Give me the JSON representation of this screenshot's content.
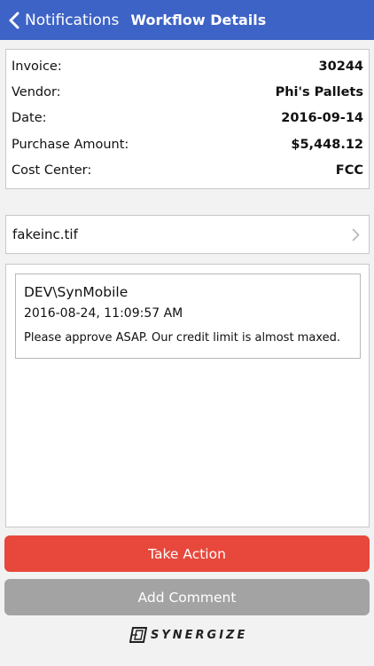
{
  "navbar": {
    "back_label": "Notifications",
    "title": "Workflow Details",
    "color": "#3e63c6"
  },
  "details": {
    "rows": [
      {
        "label": "Invoice:",
        "value": "30244"
      },
      {
        "label": "Vendor:",
        "value": "Phi's Pallets"
      },
      {
        "label": "Date:",
        "value": "2016-09-14"
      },
      {
        "label": "Purchase Amount:",
        "value": "$5,448.12"
      },
      {
        "label": "Cost Center:",
        "value": "FCC"
      }
    ]
  },
  "attachment": {
    "filename": "fakeinc.tif",
    "icon": "chevron-right-icon"
  },
  "comments": [
    {
      "user": "DEV\\SynMobile",
      "timestamp": "2016-08-24, 11:09:57 AM",
      "text": "Please approve ASAP.  Our credit limit is almost maxed."
    }
  ],
  "actions": {
    "take_action_label": "Take Action",
    "take_action_color": "#e7483b",
    "add_comment_label": "Add Comment",
    "add_comment_color": "#a3a3a3"
  },
  "footer": {
    "logo_text": "SYNERGIZE"
  }
}
